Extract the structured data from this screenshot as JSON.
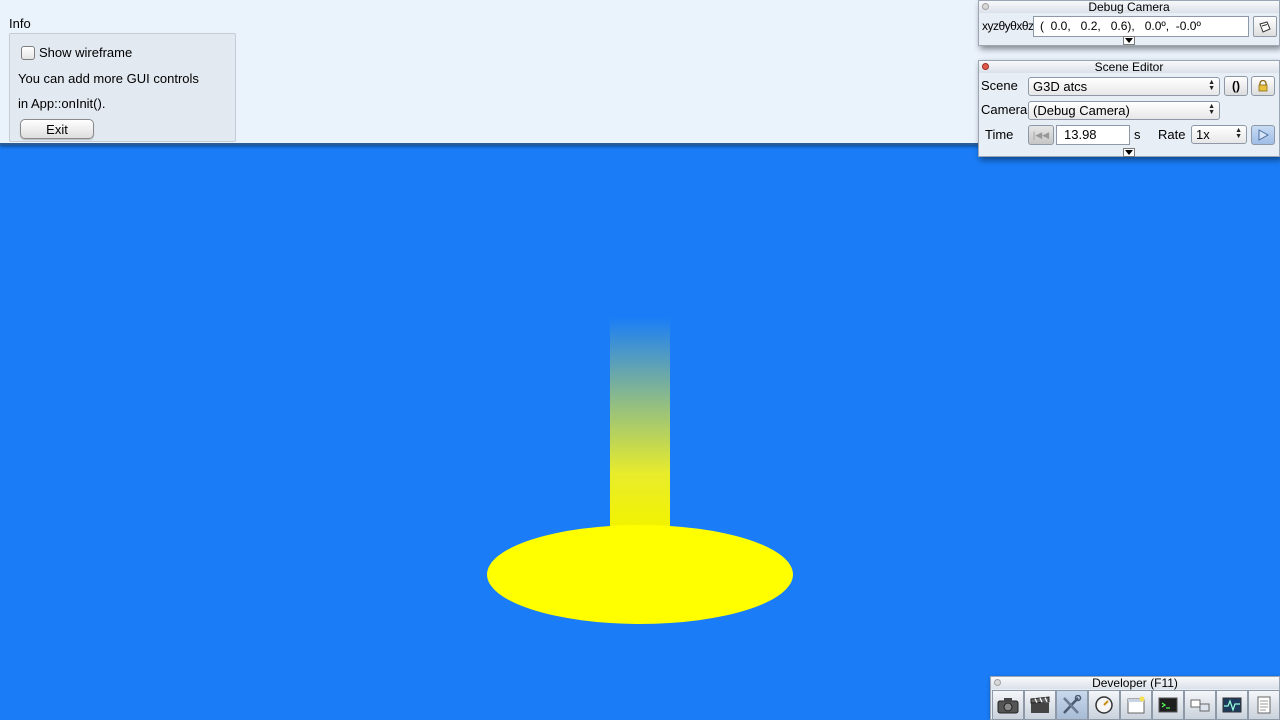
{
  "info_panel": {
    "title": "Info",
    "wireframe_label": "Show wireframe",
    "wireframe_checked": false,
    "line1": "You can add more GUI controls",
    "line2": "in App::onInit().",
    "exit_label": "Exit"
  },
  "debug_camera": {
    "title": "Debug Camera",
    "coord_label": "xyzθyθxθz",
    "coord_value": "(  0.0,   0.2,   0.6),   0.0º,  -0.0º"
  },
  "scene_editor": {
    "title": "Scene Editor",
    "scene_label": "Scene",
    "scene_value": "G3D atcs",
    "camera_label": "Camera",
    "camera_value": "(Debug Camera)",
    "time_label": "Time",
    "time_value": "13.98",
    "time_unit": "s",
    "rate_label": "Rate",
    "rate_value": "1x"
  },
  "developer_bar": {
    "title": "Developer (F11)",
    "icons": [
      "camera-icon",
      "clapperboard-icon",
      "tools-icon",
      "gauge-icon",
      "new-window-icon",
      "terminal-icon",
      "windows-icon",
      "profiler-icon",
      "notes-icon"
    ]
  },
  "colors": {
    "background": "#1a7df7",
    "disk": "#ffff00",
    "panel": "#eaf2fc"
  }
}
